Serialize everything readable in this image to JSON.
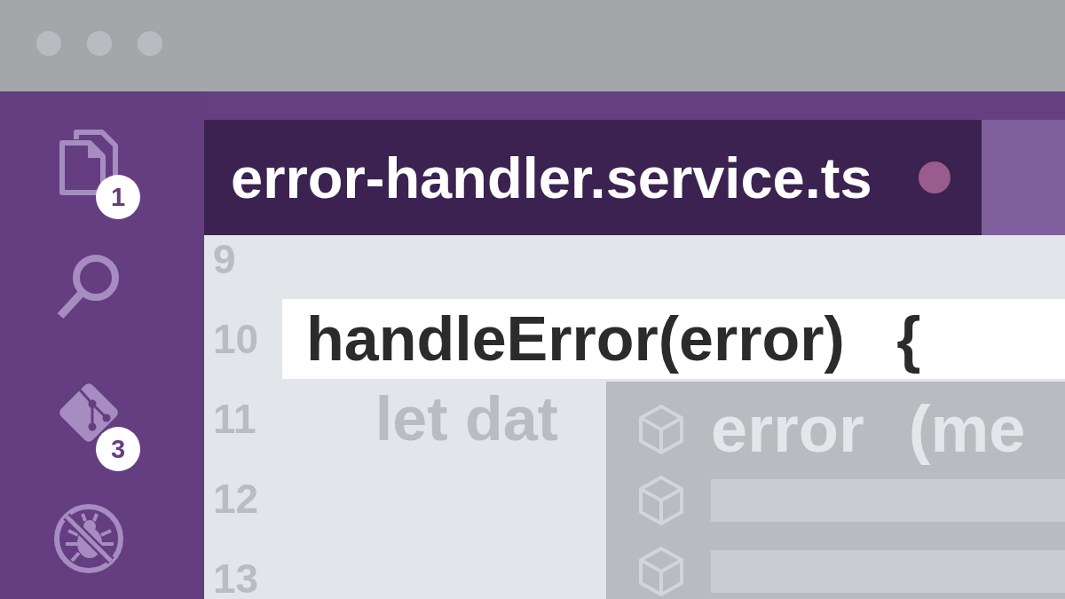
{
  "activity_bar": {
    "items": [
      {
        "kind": "files",
        "badge": "1"
      },
      {
        "kind": "search"
      },
      {
        "kind": "source-control",
        "badge": "3"
      },
      {
        "kind": "debug"
      }
    ]
  },
  "tabs": [
    {
      "label": "error-handler.service.ts",
      "selected": true,
      "modified": true
    }
  ],
  "editor": {
    "lines": [
      {
        "number": "9",
        "highlighted": false
      },
      {
        "number": "10",
        "text": "handleError(error)   {",
        "highlighted": true
      },
      {
        "number": "11",
        "text": "    let dat",
        "highlighted": false
      },
      {
        "number": "12",
        "highlighted": false
      },
      {
        "number": "13",
        "highlighted": false
      }
    ]
  },
  "suggestions": {
    "items": [
      {
        "kind": "entry",
        "label": "error",
        "detail": "(me"
      },
      {
        "kind": "blank"
      },
      {
        "kind": "blank"
      }
    ]
  }
}
